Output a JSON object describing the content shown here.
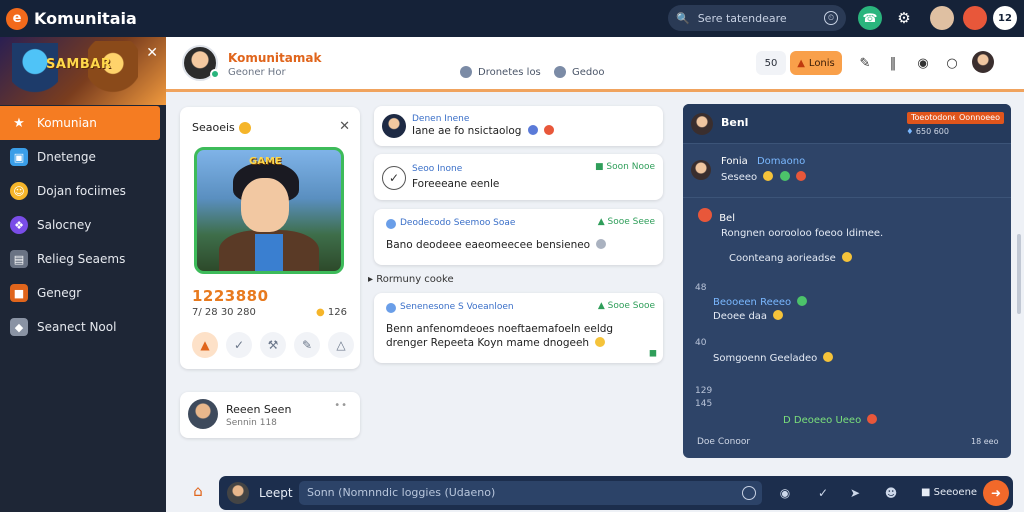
{
  "app": {
    "logo_glyph": "e",
    "title": "Komunitaia",
    "accent": "#f57c22",
    "topbar_bg": "#152238"
  },
  "topbar": {
    "search_placeholder": "Sere tatendeare",
    "badge_count": "12"
  },
  "sidebar": {
    "banner_title": "SAMBAR",
    "items": [
      {
        "label": "Komunian",
        "icon": "star-icon",
        "active": true
      },
      {
        "label": "Dnetenge",
        "icon": "window-icon",
        "active": false
      },
      {
        "label": "Dojan fociimes",
        "icon": "smiley-icon",
        "active": false
      },
      {
        "label": "Salocney",
        "icon": "compass-icon",
        "active": false
      },
      {
        "label": "Relieg Seaems",
        "icon": "inbox-icon",
        "active": false
      },
      {
        "label": "Genegr",
        "icon": "folder-icon",
        "active": false
      },
      {
        "label": "Seanect Nool",
        "icon": "cube-icon",
        "active": false
      }
    ]
  },
  "header": {
    "title": "Komunitamak",
    "subtitle": "Geoner Hor",
    "mid_a": "Dronetes los",
    "mid_b": "Gedoo",
    "btn_a": "50",
    "btn_b": "Lonis"
  },
  "profile": {
    "title": "Seaoeis",
    "badge_text": "GAME",
    "number": "1223880",
    "stat_a": "7/ 28 30 280",
    "stat_b": "126"
  },
  "user_card": {
    "name": "Reeen Seen",
    "sub": "Sennin 118",
    "dots": "••"
  },
  "feed": {
    "divider": "Rormuny cooke",
    "posts": [
      {
        "title": "Denen Inene",
        "body": "Iane ae fo nsictaolog"
      },
      {
        "title": "Seoo Inone",
        "right": "Soon Nooe",
        "body": "Foreeeane eenle"
      },
      {
        "title": "Deodecodo  Seemoo Soae",
        "right": "Sooe Seee",
        "body": "Bano deodeee eaeomeecee bensieneo"
      },
      {
        "title": "Senenesone S Voeanloen",
        "right": "Sooe Sooe",
        "body_a": "Benn anfenomdeoes noeftaemafoeln eeldg",
        "body_b": "drenger Repeeta Koyn mame dnogeeh"
      }
    ]
  },
  "chat": {
    "name": "Benl",
    "tag_a": "Toeotodone",
    "tag_b": "Oonnoeeo",
    "top_num": "650 600",
    "msgs": [
      {
        "name": "Fonia",
        "extra": "Domaono",
        "line": "Seseeo"
      },
      {
        "name": "Bel",
        "line": "Rongnen oorooloo foeoo ldimee."
      },
      {
        "text": "Coonteang aorieadse"
      },
      {
        "num": "48",
        "text": "Beooeen Reeeo"
      },
      {
        "text": "Deoee daa"
      },
      {
        "num": "40",
        "text": "Somgoenn Geeladeo"
      },
      {
        "num": "129"
      },
      {
        "num": "145"
      },
      {
        "text": "D Deoeeo Ueeo"
      },
      {
        "text": "Doe Conoor",
        "right": "18 eeo"
      }
    ]
  },
  "bottom": {
    "label": "Leept",
    "placeholder": "Sonn (Nomnndic loggies (Udaeno)",
    "send_label": "Seeoene"
  }
}
